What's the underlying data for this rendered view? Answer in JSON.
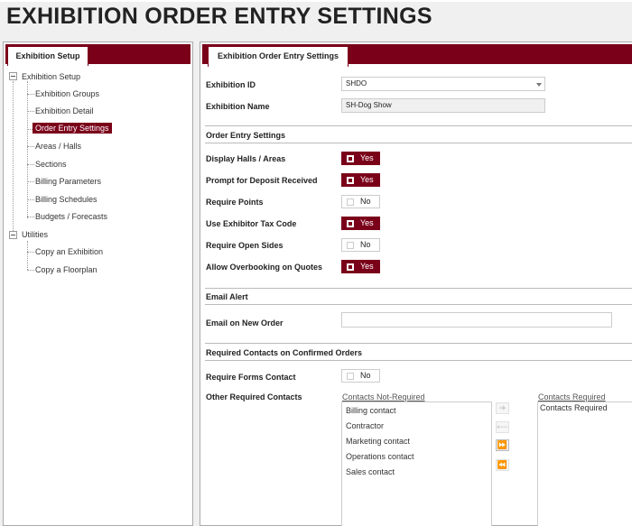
{
  "page": {
    "title": "EXHIBITION ORDER ENTRY SETTINGS"
  },
  "left_panel": {
    "tab_label": "Exhibition Setup",
    "tree": [
      {
        "label": "Exhibition Setup",
        "level": 0
      },
      {
        "label": "Exhibition Groups",
        "level": 1
      },
      {
        "label": "Exhibition Detail",
        "level": 1
      },
      {
        "label": "Order Entry Settings",
        "level": 1,
        "selected": true
      },
      {
        "label": "Areas / Halls",
        "level": 1
      },
      {
        "label": "Sections",
        "level": 1
      },
      {
        "label": "Billing Parameters",
        "level": 1
      },
      {
        "label": "Billing Schedules",
        "level": 1
      },
      {
        "label": "Budgets / Forecasts",
        "level": 1
      },
      {
        "label": "Utilities",
        "level": 0
      },
      {
        "label": "Copy an Exhibition",
        "level": 1
      },
      {
        "label": "Copy a Floorplan",
        "level": 1
      }
    ]
  },
  "right_panel": {
    "tab_label": "Exhibition Order Entry Settings",
    "exhibition_id": {
      "label": "Exhibition ID",
      "value": "SHDO"
    },
    "exhibition_name": {
      "label": "Exhibition Name",
      "value": "SH-Dog Show"
    },
    "order_entry_section": {
      "title": "Order Entry Settings"
    },
    "settings": [
      {
        "label": "Display Halls / Areas",
        "value": "Yes",
        "on": true
      },
      {
        "label": "Prompt for Deposit Received",
        "value": "Yes",
        "on": true
      },
      {
        "label": "Require Points",
        "value": "No",
        "on": false
      },
      {
        "label": "Use Exhibitor Tax Code",
        "value": "Yes",
        "on": true
      },
      {
        "label": "Require Open Sides",
        "value": "No",
        "on": false
      },
      {
        "label": "Allow Overbooking on Quotes",
        "value": "Yes",
        "on": true
      }
    ],
    "email_section": {
      "title": "Email Alert",
      "email_label": "Email on New Order",
      "email_value": ""
    },
    "contacts_section": {
      "title": "Required Contacts on Confirmed Orders",
      "require_forms_label": "Require Forms Contact",
      "require_forms_value": "No",
      "other_label": "Other Required Contacts",
      "not_required_caption": "Contacts Not-Required",
      "required_caption": "Contacts Required",
      "not_required_items": [
        "Billing contact",
        "Contractor",
        "Marketing contact",
        "Operations contact",
        "Sales contact"
      ],
      "required_items": [
        "Contacts Required"
      ],
      "move_buttons": [
        "➜",
        "⟵",
        "⏩",
        "⏪"
      ]
    },
    "colors": {
      "accent": "#7a0019"
    }
  }
}
